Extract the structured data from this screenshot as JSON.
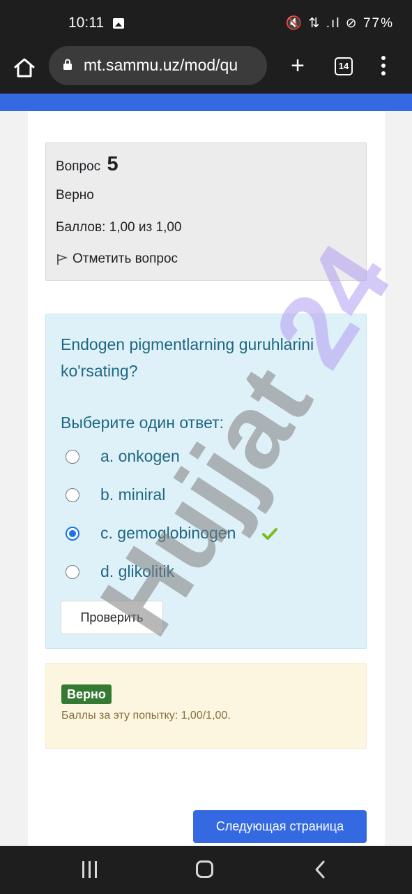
{
  "status_bar": {
    "time": "10:11",
    "right_indicators": "🔇 ⇅ .ıl ⊘ 77%"
  },
  "browser": {
    "url": "mt.sammu.uz/mod/qu",
    "tab_count": "14"
  },
  "question_info": {
    "label": "Вопрос",
    "number": "5",
    "state": "Верно",
    "grade": "Баллов: 1,00 из 1,00",
    "flag_label": "Отметить вопрос"
  },
  "question": {
    "text": "Endogen pigmentlarning guruhlarini ko'rsating?",
    "prompt": "Выберите один ответ:",
    "answers": [
      {
        "label": "a. onkogen",
        "selected": false
      },
      {
        "label": "b. miniral",
        "selected": false
      },
      {
        "label": "c. gemoglobinogen",
        "selected": true,
        "correct": true
      },
      {
        "label": "d. glikolitik",
        "selected": false
      }
    ],
    "check_button": "Проверить"
  },
  "feedback": {
    "badge": "Верно",
    "text": "Баллы за эту попытку: 1,00/1,00."
  },
  "next_button": "Следующая страница",
  "watermark": "Hujjat 24",
  "colors": {
    "accent": "#3569e2",
    "question_text": "#1f6782",
    "correct": "#357a32",
    "check_mark": "#7fba1e"
  }
}
